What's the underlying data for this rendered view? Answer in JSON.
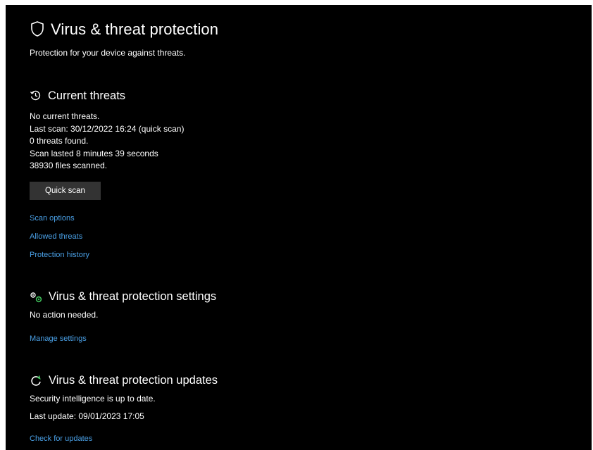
{
  "page": {
    "title": "Virus & threat protection",
    "subtitle": "Protection for your device against threats."
  },
  "current_threats": {
    "icon": "history-shield-icon",
    "heading": "Current threats",
    "lines": [
      "No current threats.",
      "Last scan: 30/12/2022 16:24 (quick scan)",
      "0 threats found.",
      "Scan lasted 8 minutes 39 seconds",
      "38930 files scanned."
    ],
    "quick_scan_label": "Quick scan",
    "links": [
      "Scan options",
      "Allowed threats",
      "Protection history"
    ]
  },
  "settings": {
    "icon": "gears-icon",
    "heading": "Virus & threat protection settings",
    "status": "No action needed.",
    "manage_link": "Manage settings"
  },
  "updates": {
    "icon": "refresh-icon",
    "heading": "Virus & threat protection updates",
    "status": "Security intelligence is up to date.",
    "last_update": "Last update: 09/01/2023 17:05",
    "check_link": "Check for updates"
  },
  "colors": {
    "background": "#000000",
    "text": "#ffffff",
    "link": "#4aa0e6",
    "button": "#333333",
    "accent_green": "#3fbf5a"
  }
}
